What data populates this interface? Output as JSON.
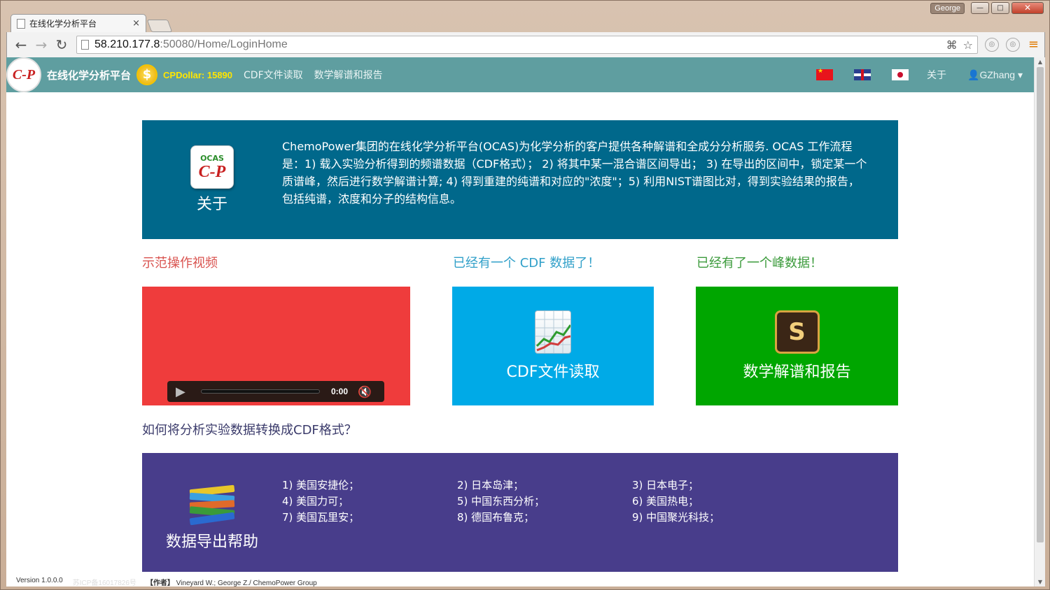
{
  "browser": {
    "profile_name": "George",
    "tab_title": "在线化学分析平台",
    "tab_close": "×",
    "url_host": "58.210.177.8",
    "url_rest": ":50080/Home/LoginHome",
    "controls": {
      "minimize": "—",
      "maximize": "□",
      "close": "✕"
    }
  },
  "navbar": {
    "logo_text": "C-P",
    "brand": "在线化学分析平台",
    "coin_symbol": "$",
    "cpdollar": "CPDollar: 15890",
    "links": [
      "CDF文件读取",
      "数学解谱和报告"
    ],
    "about": "关于",
    "user": "GZhang",
    "user_icon": "👤",
    "caret": "▾",
    "flags": [
      "flag-china-icon",
      "flag-uk-icon",
      "flag-japan-icon"
    ]
  },
  "about": {
    "icon_top": "OCAS",
    "icon_main": "C-P",
    "title": "关于",
    "text": "ChemoPower集团的在线化学分析平台(OCAS)为化学分析的客户提供各种解谱和全成分分析服务. OCAS 工作流程是：1) 载入实验分析得到的频谱数据（CDF格式）； 2) 将其中某一混合谱区间导出； 3) 在导出的区间中，锁定某一个质谱峰，然后进行数学解谱计算; 4) 得到重建的纯谱和对应的\"浓度\"；5) 利用NIST谱图比对，得到实验结果的报告，包括纯谱，浓度和分子的结构信息。"
  },
  "sections": {
    "video_title": "示范操作视频",
    "cdf_title": "已经有一个 CDF 数据了！",
    "peak_title": "已经有了一个峰数据！"
  },
  "tiles": {
    "cdf_label": "CDF文件读取",
    "math_label": "数学解谱和报告",
    "math_glyph": "S",
    "player": {
      "time": "0:00",
      "play": "▶",
      "mute": "🔇"
    }
  },
  "howto": {
    "title": "如何将分析实验数据转换成CDF格式？"
  },
  "help": {
    "title": "数据导出帮助",
    "vendors": [
      "1) 美国安捷伦；",
      "2) 日本岛津；",
      "3) 日本电子；",
      "4) 美国力可；",
      "5) 中国东西分析；",
      "6) 美国热电；",
      "7) 美国瓦里安；",
      "8) 德国布鲁克；",
      "9) 中国聚光科技；"
    ]
  },
  "footer": {
    "version": "Version 1.0.0.0",
    "faded": "苏ICP备16017826号",
    "author_label": "【作者】",
    "author": "Vineyard W.; George Z./ ChemoPower Group"
  },
  "colors": {
    "navbar": "#5f9ea0",
    "about_bg": "#00688b",
    "video_tile": "#ef3c3c",
    "cdf_tile": "#00aae7",
    "math_tile": "#00a600",
    "help_bg": "#483d8b",
    "cpdollar": "#ffe600"
  }
}
